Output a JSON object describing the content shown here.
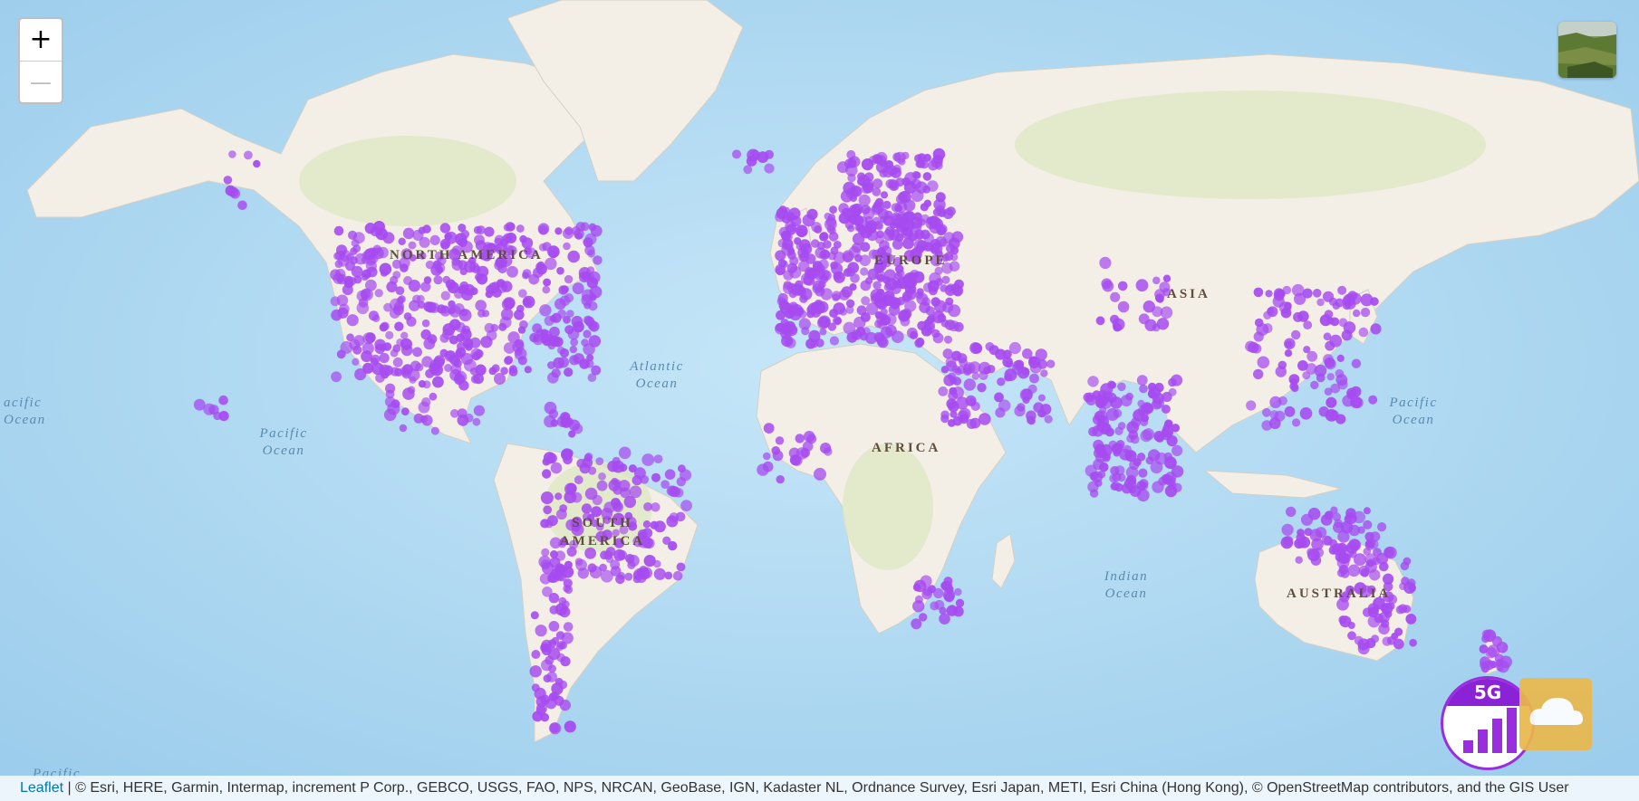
{
  "map": {
    "continent_labels": [
      "NORTH AMERICA",
      "SOUTH AMERICA",
      "EUROPE",
      "AFRICA",
      "ASIA",
      "AUSTRALIA"
    ],
    "ocean_labels": [
      "Pacific Ocean",
      "Atlantic Ocean",
      "Indian Ocean",
      "Pacific Ocean",
      "acific Ocean",
      "Pacific"
    ],
    "marker_color": "#a64bf0",
    "marker_cluster_regions": [
      "North America",
      "Central America",
      "Caribbean",
      "South America",
      "Europe",
      "Middle East",
      "Africa",
      "South Asia",
      "Southeast Asia",
      "East Asia",
      "Australia",
      "New Zealand",
      "Hawaii",
      "Alaska",
      "Iceland"
    ]
  },
  "controls": {
    "zoom_in_label": "+",
    "zoom_out_label": "—",
    "basemap_toggle_icon": "satellite-thumbnail-icon"
  },
  "logo": {
    "text": "5G",
    "icon": "signal-bars-icon",
    "color": "#8a22d6"
  },
  "upload_button": {
    "icon": "cloud-upload-icon",
    "color": "#eab84c"
  },
  "attribution": {
    "link_text": "Leaflet",
    "separator": " | ",
    "text": "© Esri, HERE, Garmin, Intermap, increment P Corp., GEBCO, USGS, FAO, NPS, NRCAN, GeoBase, IGN, Kadaster NL, Ordnance Survey, Esri Japan, METI, Esri China (Hong Kong), © OpenStreetMap contributors, and the GIS User"
  }
}
